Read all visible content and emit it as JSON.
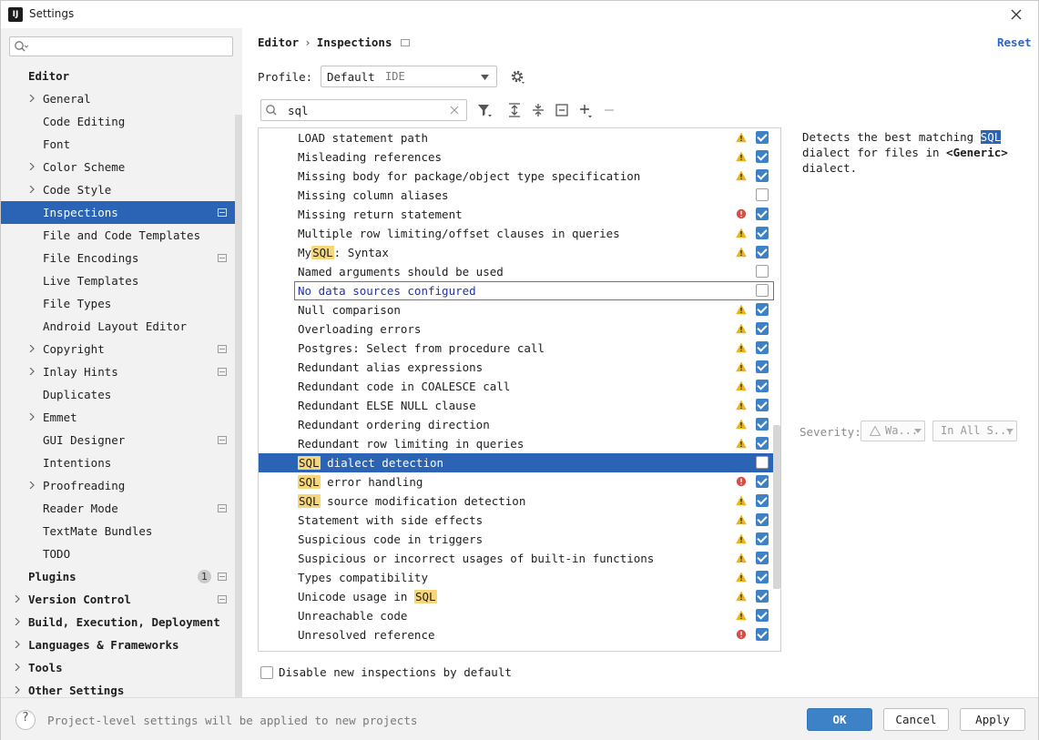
{
  "window": {
    "title": "Settings"
  },
  "sidebar": {
    "search": {
      "placeholder": ""
    },
    "items": [
      {
        "label": "Editor",
        "bold": true,
        "expandable": false,
        "indent": 0,
        "project": false
      },
      {
        "label": "General",
        "bold": false,
        "expandable": true,
        "indent": 1,
        "project": false
      },
      {
        "label": "Code Editing",
        "bold": false,
        "expandable": false,
        "indent": 1,
        "project": false
      },
      {
        "label": "Font",
        "bold": false,
        "expandable": false,
        "indent": 1,
        "project": false
      },
      {
        "label": "Color Scheme",
        "bold": false,
        "expandable": true,
        "indent": 1,
        "project": false
      },
      {
        "label": "Code Style",
        "bold": false,
        "expandable": true,
        "indent": 1,
        "project": false
      },
      {
        "label": "Inspections",
        "bold": false,
        "expandable": false,
        "indent": 1,
        "project": true,
        "selected": true
      },
      {
        "label": "File and Code Templates",
        "bold": false,
        "expandable": false,
        "indent": 1,
        "project": false
      },
      {
        "label": "File Encodings",
        "bold": false,
        "expandable": false,
        "indent": 1,
        "project": true
      },
      {
        "label": "Live Templates",
        "bold": false,
        "expandable": false,
        "indent": 1,
        "project": false
      },
      {
        "label": "File Types",
        "bold": false,
        "expandable": false,
        "indent": 1,
        "project": false
      },
      {
        "label": "Android Layout Editor",
        "bold": false,
        "expandable": false,
        "indent": 1,
        "project": false
      },
      {
        "label": "Copyright",
        "bold": false,
        "expandable": true,
        "indent": 1,
        "project": true
      },
      {
        "label": "Inlay Hints",
        "bold": false,
        "expandable": true,
        "indent": 1,
        "project": true
      },
      {
        "label": "Duplicates",
        "bold": false,
        "expandable": false,
        "indent": 1,
        "project": false
      },
      {
        "label": "Emmet",
        "bold": false,
        "expandable": true,
        "indent": 1,
        "project": false
      },
      {
        "label": "GUI Designer",
        "bold": false,
        "expandable": false,
        "indent": 1,
        "project": true
      },
      {
        "label": "Intentions",
        "bold": false,
        "expandable": false,
        "indent": 1,
        "project": false
      },
      {
        "label": "Proofreading",
        "bold": false,
        "expandable": true,
        "indent": 1,
        "project": false
      },
      {
        "label": "Reader Mode",
        "bold": false,
        "expandable": false,
        "indent": 1,
        "project": true
      },
      {
        "label": "TextMate Bundles",
        "bold": false,
        "expandable": false,
        "indent": 1,
        "project": false
      },
      {
        "label": "TODO",
        "bold": false,
        "expandable": false,
        "indent": 1,
        "project": false
      },
      {
        "label": "Plugins",
        "bold": true,
        "expandable": false,
        "indent": 0,
        "project": true,
        "badge": "1"
      },
      {
        "label": "Version Control",
        "bold": true,
        "expandable": true,
        "indent": 0,
        "project": true
      },
      {
        "label": "Build, Execution, Deployment",
        "bold": true,
        "expandable": true,
        "indent": 0,
        "project": false
      },
      {
        "label": "Languages & Frameworks",
        "bold": true,
        "expandable": true,
        "indent": 0,
        "project": false
      },
      {
        "label": "Tools",
        "bold": true,
        "expandable": true,
        "indent": 0,
        "project": false
      },
      {
        "label": "Other Settings",
        "bold": true,
        "expandable": true,
        "indent": 0,
        "project": false
      }
    ]
  },
  "header": {
    "breadcrumb": [
      "Editor",
      "Inspections"
    ],
    "breadcrumb_sep": "›",
    "reset_label": "Reset"
  },
  "profile": {
    "label": "Profile:",
    "value": "Default",
    "kind": "IDE"
  },
  "filter": {
    "value": "sql"
  },
  "inspections": [
    {
      "parts": [
        [
          "LOAD statement path",
          false
        ]
      ],
      "severity": "warning",
      "checked": true
    },
    {
      "parts": [
        [
          "Misleading references",
          false
        ]
      ],
      "severity": "warning",
      "checked": true
    },
    {
      "parts": [
        [
          "Missing body for package/object type specification",
          false
        ]
      ],
      "severity": "warning",
      "checked": true
    },
    {
      "parts": [
        [
          "Missing column aliases",
          false
        ]
      ],
      "severity": "none",
      "checked": false
    },
    {
      "parts": [
        [
          "Missing return statement",
          false
        ]
      ],
      "severity": "error",
      "checked": true
    },
    {
      "parts": [
        [
          "Multiple row limiting/offset clauses in queries",
          false
        ]
      ],
      "severity": "warning",
      "checked": true
    },
    {
      "parts": [
        [
          "My",
          false
        ],
        [
          "SQL",
          true
        ],
        [
          ": Syntax",
          false
        ]
      ],
      "severity": "warning",
      "checked": true
    },
    {
      "parts": [
        [
          "Named arguments should be used",
          false
        ]
      ],
      "severity": "none",
      "checked": false
    },
    {
      "parts": [
        [
          "No data sources configured",
          false
        ]
      ],
      "severity": "none",
      "checked": false,
      "focused": true
    },
    {
      "parts": [
        [
          "Null comparison",
          false
        ]
      ],
      "severity": "warning",
      "checked": true
    },
    {
      "parts": [
        [
          "Overloading errors",
          false
        ]
      ],
      "severity": "warning",
      "checked": true
    },
    {
      "parts": [
        [
          "Postgres: Select from procedure call",
          false
        ]
      ],
      "severity": "warning",
      "checked": true
    },
    {
      "parts": [
        [
          "Redundant alias expressions",
          false
        ]
      ],
      "severity": "warning",
      "checked": true
    },
    {
      "parts": [
        [
          "Redundant code in COALESCE call",
          false
        ]
      ],
      "severity": "warning",
      "checked": true
    },
    {
      "parts": [
        [
          "Redundant ELSE NULL clause",
          false
        ]
      ],
      "severity": "warning",
      "checked": true
    },
    {
      "parts": [
        [
          "Redundant ordering direction",
          false
        ]
      ],
      "severity": "warning",
      "checked": true
    },
    {
      "parts": [
        [
          "Redundant row limiting in queries",
          false
        ]
      ],
      "severity": "warning",
      "checked": true
    },
    {
      "parts": [
        [
          "SQL",
          true
        ],
        [
          " dialect detection",
          false
        ]
      ],
      "severity": "none",
      "checked": false,
      "selected": true
    },
    {
      "parts": [
        [
          "SQL",
          true
        ],
        [
          " error handling",
          false
        ]
      ],
      "severity": "error",
      "checked": true
    },
    {
      "parts": [
        [
          "SQL",
          true
        ],
        [
          " source modification detection",
          false
        ]
      ],
      "severity": "warning",
      "checked": true
    },
    {
      "parts": [
        [
          "Statement with side effects",
          false
        ]
      ],
      "severity": "warning",
      "checked": true
    },
    {
      "parts": [
        [
          "Suspicious code in triggers",
          false
        ]
      ],
      "severity": "warning",
      "checked": true
    },
    {
      "parts": [
        [
          "Suspicious or incorrect usages of built-in functions",
          false
        ]
      ],
      "severity": "warning",
      "checked": true
    },
    {
      "parts": [
        [
          "Types compatibility",
          false
        ]
      ],
      "severity": "warning",
      "checked": true
    },
    {
      "parts": [
        [
          "Unicode usage in ",
          false
        ],
        [
          "SQL",
          true
        ]
      ],
      "severity": "warning",
      "checked": true
    },
    {
      "parts": [
        [
          "Unreachable code",
          false
        ]
      ],
      "severity": "warning",
      "checked": true
    },
    {
      "parts": [
        [
          "Unresolved reference",
          false
        ]
      ],
      "severity": "error",
      "checked": true
    }
  ],
  "description": {
    "before": "Detects the best matching ",
    "selected": "SQL",
    "middle": " dialect for files in ",
    "bold": "<Generic>",
    "after": " dialect."
  },
  "severity": {
    "label": "Severity:",
    "level": "Wa...",
    "scope": "In All S..."
  },
  "disable_new": {
    "label": "Disable new inspections by default",
    "checked": false
  },
  "footer": {
    "help": "?",
    "note": "Project-level settings will be applied to new projects",
    "ok": "OK",
    "cancel": "Cancel",
    "apply": "Apply"
  },
  "colors": {
    "accent": "#2b64b5",
    "warning": "#e8b51b",
    "error": "#d64f45",
    "checkbox": "#3d82c7",
    "highlight": "#f6d67a"
  }
}
